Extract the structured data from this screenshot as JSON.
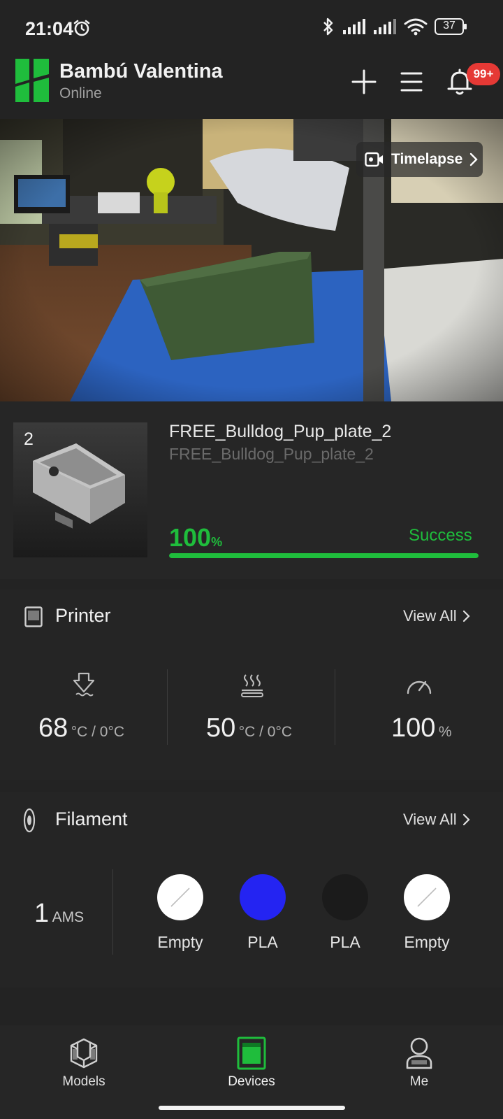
{
  "status_bar": {
    "time": "21:04",
    "battery": "37",
    "icons": [
      "alarm-icon",
      "bluetooth-icon",
      "signal-icon",
      "signal-icon",
      "wifi-icon",
      "battery-icon"
    ]
  },
  "header": {
    "printer_name": "Bambú Valentina",
    "printer_status": "Online",
    "notification_count": "99+",
    "brand_color": "#1fbd3c"
  },
  "camera": {
    "timelapse_label": "Timelapse"
  },
  "job": {
    "plate_number": "2",
    "title": "FREE_Bulldog_Pup_plate_2",
    "subtitle": "FREE_Bulldog_Pup_plate_2",
    "progress_value": "100",
    "progress_unit": "%",
    "progress_fraction": 1.0,
    "status": "Success"
  },
  "printer_section": {
    "title": "Printer",
    "view_all": "View All",
    "nozzle": {
      "value": "68",
      "unit": "°C / 0°C"
    },
    "bed": {
      "value": "50",
      "unit": "°C / 0°C"
    },
    "speed": {
      "value": "100",
      "unit": "%"
    }
  },
  "filament_section": {
    "title": "Filament",
    "view_all": "View All",
    "ams_count": "1",
    "ams_label": "AMS",
    "slots": [
      {
        "label": "Empty",
        "color": "#ffffff",
        "empty": true
      },
      {
        "label": "PLA",
        "color": "#2424f2",
        "empty": false
      },
      {
        "label": "PLA",
        "color": "#1b1b1b",
        "empty": false
      },
      {
        "label": "Empty",
        "color": "#ffffff",
        "empty": true
      }
    ]
  },
  "bottom_nav": {
    "items": [
      {
        "label": "Models",
        "active": false
      },
      {
        "label": "Devices",
        "active": true
      },
      {
        "label": "Me",
        "active": false
      }
    ]
  }
}
